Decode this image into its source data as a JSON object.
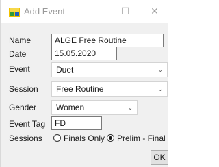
{
  "window": {
    "title": "Add Event",
    "minimize": "—",
    "maximize": "☐",
    "close": "✕",
    "icon": "app-logo-icon"
  },
  "form": {
    "name_label": "Name",
    "name_value": "ALGE Free Routine",
    "date_label": "Date",
    "date_value": "15.05.2020",
    "event_label": "Event",
    "event_value": "Duet",
    "session_label": "Session",
    "session_value": "Free Routine",
    "gender_label": "Gender",
    "gender_value": "Women",
    "event_tag_label": "Event Tag",
    "event_tag_value": "FD",
    "sessions_label": "Sessions",
    "sessions_options": [
      "Finals Only",
      "Prelim - Final"
    ],
    "sessions_selected": "Prelim - Final"
  },
  "buttons": {
    "ok": "OK"
  },
  "colors": {
    "dialog_bg": "#f0f0f0",
    "titlebar_bg": "#ffffff",
    "icon_yellow": "#f2c200",
    "icon_green": "#2e9a3a",
    "icon_blue": "#1f5fbf"
  }
}
